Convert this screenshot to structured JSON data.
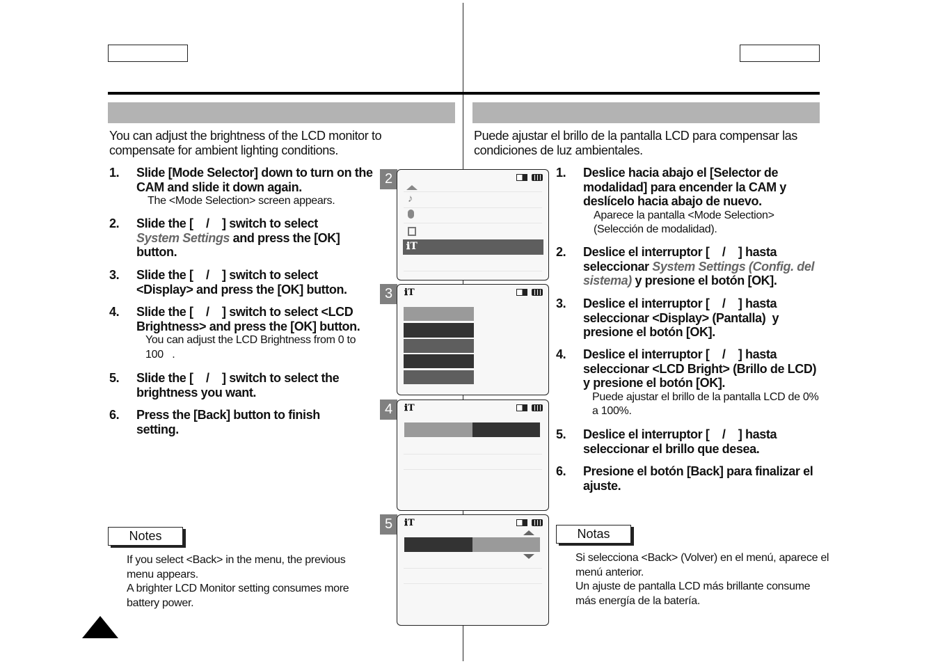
{
  "left": {
    "intro": "You can adjust the brightness of the LCD monitor to compensate for ambient lighting conditions.",
    "steps": [
      {
        "num": "1.",
        "text": "Slide [Mode Selector] down to turn on the CAM and slide it down again.",
        "sub": "The <Mode Selection> screen appears."
      },
      {
        "num": "2.",
        "pre": "Slide the [    /    ] switch to select ",
        "italic": "System Settings",
        "post": " and press the [OK] button."
      },
      {
        "num": "3.",
        "text": "Slide the [    /    ] switch to select <Display> and press the [OK] button."
      },
      {
        "num": "4.",
        "text": "Slide the [    /    ] switch to select <LCD Brightness> and press the [OK] button.",
        "sub": "You can adjust the LCD Brightness from 0 to 100   ."
      },
      {
        "num": "5.",
        "text": "Slide the [    /    ] switch to select the brightness you want."
      },
      {
        "num": "6.",
        "text": "Press the [Back] button to finish setting."
      }
    ],
    "notes_label": "Notes",
    "notes": [
      "If you select <Back> in the menu, the previous menu appears.",
      "A brighter LCD Monitor setting consumes more battery power."
    ]
  },
  "right": {
    "intro": "Puede ajustar el brillo de la pantalla LCD para compensar las condiciones de luz ambientales.",
    "steps": [
      {
        "num": "1.",
        "text": "Deslice hacia abajo el [Selector de modalidad] para encender la CAM y deslícelo hacia abajo de nuevo.",
        "sub": "Aparece la pantalla <Mode Selection> (Selección de modalidad)."
      },
      {
        "num": "2.",
        "pre": "Deslice el interruptor [    /    ] hasta seleccionar ",
        "italic": "System Settings (Config. del sistema)",
        "post": " y presione el botón [OK]."
      },
      {
        "num": "3.",
        "text": "Deslice el interruptor [    /    ] hasta seleccionar <Display> (Pantalla)  y presione el botón [OK]."
      },
      {
        "num": "4.",
        "text": "Deslice el interruptor [    /    ] hasta seleccionar <LCD Bright> (Brillo de LCD) y presione el botón [OK].",
        "sub": "Puede ajustar el brillo de la pantalla LCD de 0% a 100%."
      },
      {
        "num": "5.",
        "text": "Deslice el interruptor [    /    ] hasta seleccionar el brillo que desea."
      },
      {
        "num": "6.",
        "text": "Presione el botón [Back] para finalizar el ajuste."
      }
    ],
    "notes_label": "Notas",
    "notes": [
      "Si selecciona <Back> (Volver) en el menú, aparece el menú anterior.",
      "Un ajuste de pantalla LCD más brillante consume más energía de la batería."
    ]
  },
  "screens": [
    {
      "badge": "2",
      "icons": [
        "up-arrow-icon",
        "music-icon",
        "microphone-icon",
        "file-icon",
        "system-settings-icon"
      ],
      "selected": "system-settings-icon"
    },
    {
      "badge": "3",
      "icon": "system-settings-icon"
    },
    {
      "badge": "4",
      "icon": "system-settings-icon",
      "bar_left_fill": 0.5
    },
    {
      "badge": "5",
      "icon": "system-settings-icon",
      "bar_left_fill": 0.5
    }
  ],
  "colors": {
    "header_bar": "#b3b3b3",
    "italic_text": "#666666",
    "badge": "#808080",
    "selected_row": "#5e5e5e"
  }
}
